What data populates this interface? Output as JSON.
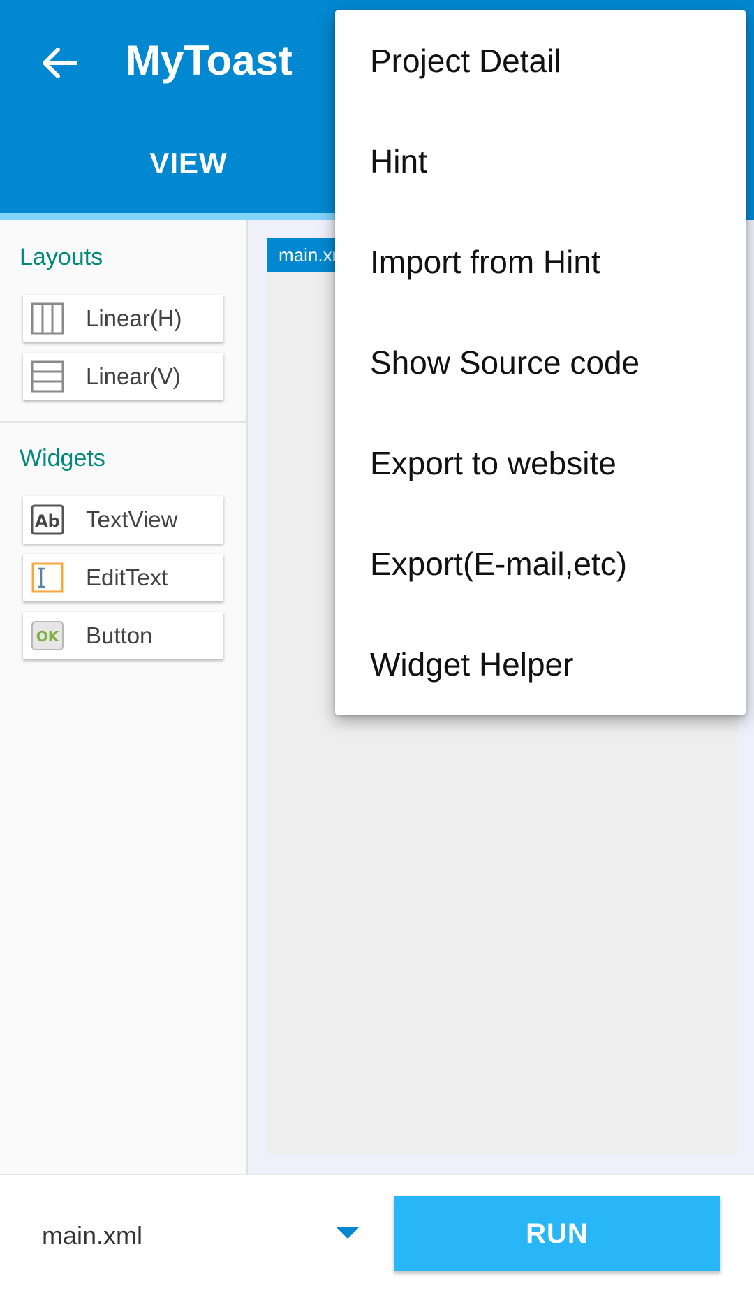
{
  "appbar": {
    "title": "MyToast",
    "back_icon": "arrow-left-icon",
    "tabs": [
      {
        "label": "VIEW"
      }
    ]
  },
  "palette": {
    "layouts_title": "Layouts",
    "layouts": [
      {
        "label": "Linear(H)",
        "icon": "linear-horizontal-icon"
      },
      {
        "label": "Linear(V)",
        "icon": "linear-vertical-icon"
      }
    ],
    "widgets_title": "Widgets",
    "widgets": [
      {
        "label": "TextView",
        "icon": "textview-icon"
      },
      {
        "label": "EditText",
        "icon": "edittext-icon"
      },
      {
        "label": "Button",
        "icon": "button-icon"
      }
    ]
  },
  "canvas": {
    "tab_label": "main.xml"
  },
  "bottom": {
    "file_name": "main.xml",
    "run_label": "RUN"
  },
  "menu": {
    "items": [
      {
        "label": "Project Detail"
      },
      {
        "label": "Hint"
      },
      {
        "label": "Import from Hint"
      },
      {
        "label": "Show Source code"
      },
      {
        "label": "Export to website"
      },
      {
        "label": "Export(E-mail,etc)"
      },
      {
        "label": "Widget Helper"
      }
    ]
  },
  "colors": {
    "primary": "#0288d1",
    "accent_light": "#81d4fa",
    "run_button": "#29b6f6",
    "section_title": "#00897b"
  }
}
